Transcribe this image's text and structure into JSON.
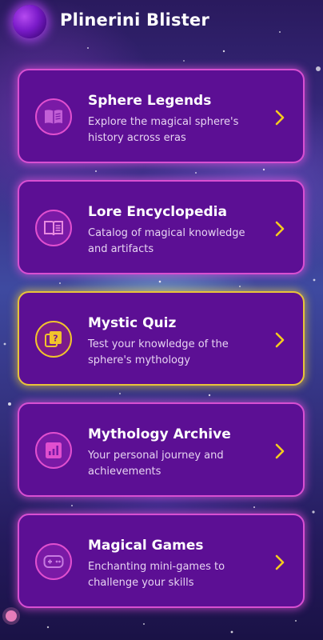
{
  "app": {
    "title": "Plinerini Blister"
  },
  "cards": [
    {
      "title": "Sphere Legends",
      "description": "Explore the magical sphere's history across eras",
      "icon": "open-book-icon",
      "accent": "#d84fd2"
    },
    {
      "title": "Lore Encyclopedia",
      "description": "Catalog of magical knowledge and artifacts",
      "icon": "book-icon",
      "accent": "#d84fd2"
    },
    {
      "title": "Mystic Quiz",
      "description": "Test your knowledge of the sphere's mythology",
      "icon": "quiz-icon",
      "accent": "#e8c33a"
    },
    {
      "title": "Mythology Archive",
      "description": "Your personal journey and achievements",
      "icon": "bar-chart-icon",
      "accent": "#d84fd2"
    },
    {
      "title": "Magical Games",
      "description": "Enchanting mini-games to challenge your skills",
      "icon": "gamepad-icon",
      "accent": "#d84fd2"
    }
  ],
  "colors": {
    "card_background": "#5c0f94",
    "chevron": "#f5cc1e",
    "icon_stroke": "#e14fcf",
    "icon_stroke_active": "#f2c42c"
  }
}
